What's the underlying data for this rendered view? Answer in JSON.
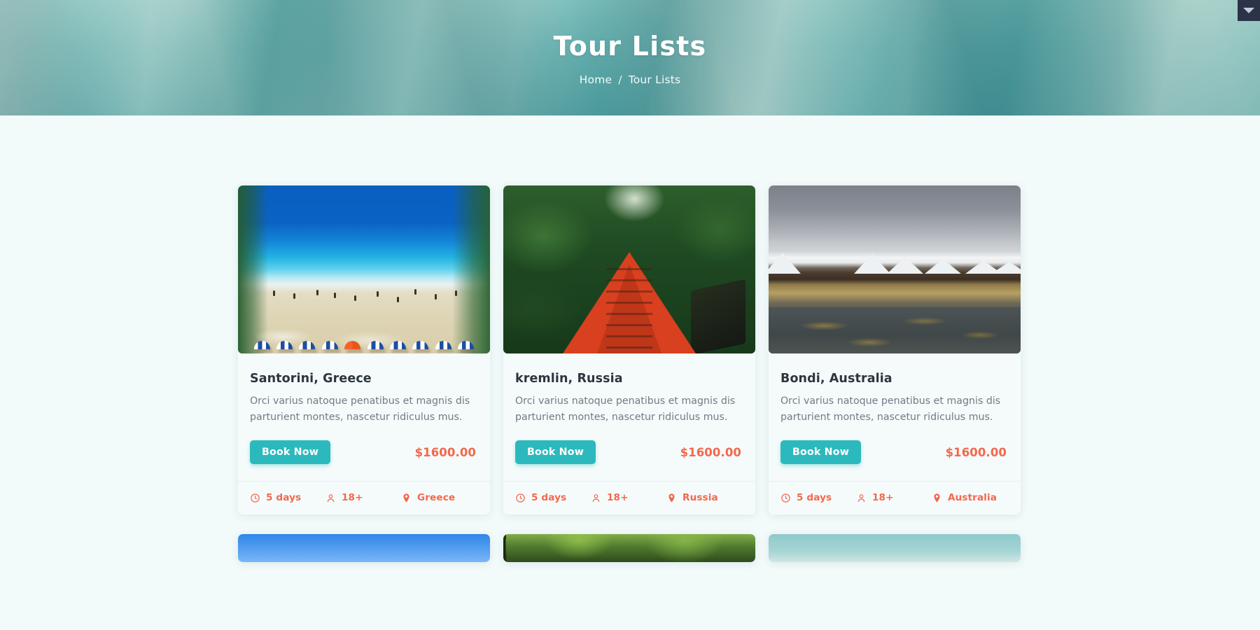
{
  "hero": {
    "title": "Tour Lists",
    "breadcrumb": {
      "home_label": "Home",
      "separator": "/",
      "current_label": "Tour Lists"
    }
  },
  "corner": {
    "icon": "chevron-down-icon"
  },
  "common": {
    "description": "Orci varius natoque penatibus et magnis dis parturient montes, nascetur ridiculus mus.",
    "book_label": "Book Now",
    "duration_icon": "clock-icon",
    "age_icon": "person-icon",
    "location_icon": "map-pin-icon"
  },
  "tours": [
    {
      "title": "Santorini, Greece",
      "description": "Orci varius natoque penatibus et magnis dis parturient montes, nascetur ridiculus mus.",
      "book_label": "Book Now",
      "price": "$1600.00",
      "duration": "5 days",
      "age": "18+",
      "location": "Greece",
      "photo": "beach"
    },
    {
      "title": "kremlin, Russia",
      "description": "Orci varius natoque penatibus et magnis dis parturient montes, nascetur ridiculus mus.",
      "book_label": "Book Now",
      "price": "$1600.00",
      "duration": "5 days",
      "age": "18+",
      "location": "Russia",
      "photo": "forest"
    },
    {
      "title": "Bondi, Australia",
      "description": "Orci varius natoque penatibus et magnis dis parturient montes, nascetur ridiculus mus.",
      "book_label": "Book Now",
      "price": "$1600.00",
      "duration": "5 days",
      "age": "18+",
      "location": "Australia",
      "photo": "tundra"
    }
  ],
  "second_row": [
    {
      "photo": "sky"
    },
    {
      "photo": "trees"
    },
    {
      "photo": "teal"
    }
  ],
  "colors": {
    "accent_teal": "#2cb9bd",
    "accent_coral": "#f4684c",
    "page_background": "#f2fafa",
    "card_background": "#f5fbfb",
    "heading": "#2c3640",
    "body_text": "#6f7b85",
    "hero_overlay": "#5bb3b2",
    "corner_panel": "#2b3348"
  }
}
